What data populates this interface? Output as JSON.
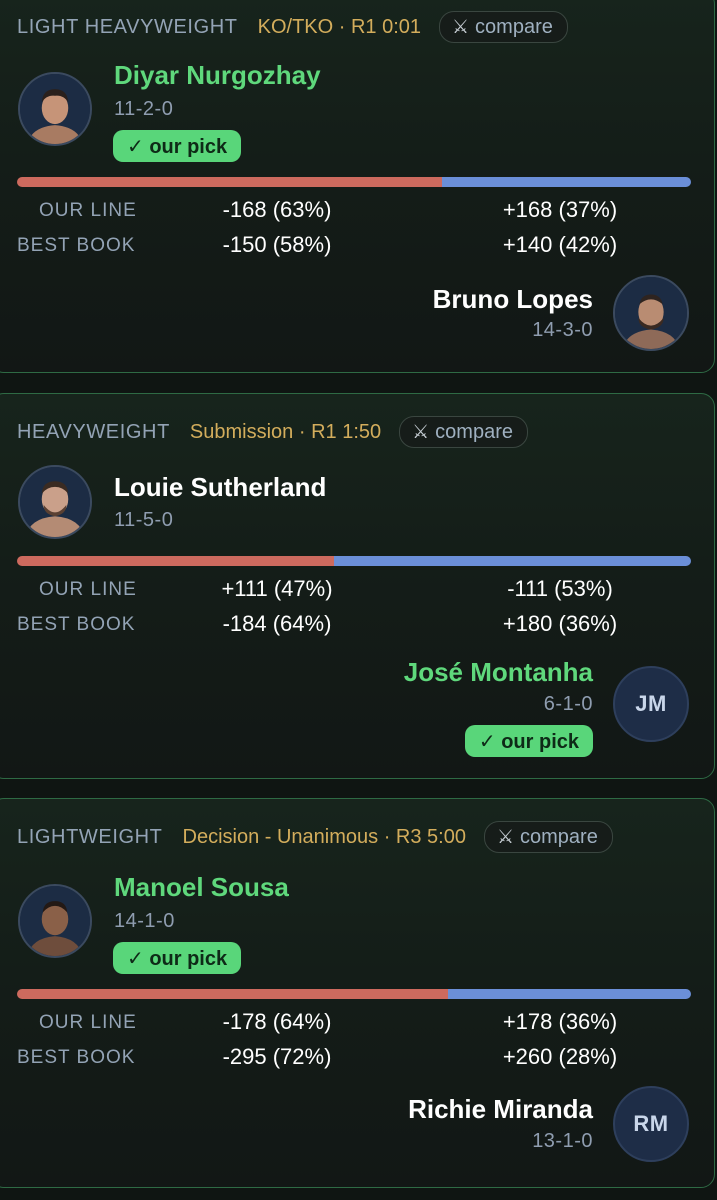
{
  "fights": [
    {
      "weight_class": "LIGHT HEAVYWEIGHT",
      "method": "KO/TKO · R1 0:01",
      "compare_label": "compare",
      "red": {
        "name": "Diyar Nurgozhay",
        "record": "11-2-0",
        "pick": true
      },
      "blue": {
        "name": "Bruno Lopes",
        "record": "14-3-0",
        "pick": false
      },
      "red_pct": 63,
      "our_line": {
        "label": "OUR LINE",
        "red": "-168 (63%)",
        "blue": "+168 (37%)"
      },
      "best_book": {
        "label": "BEST BOOK",
        "red": "-150 (58%)",
        "blue": "+140 (42%)"
      }
    },
    {
      "weight_class": "HEAVYWEIGHT",
      "method": "Submission · R1 1:50",
      "compare_label": "compare",
      "red": {
        "name": "Louie Sutherland",
        "record": "11-5-0",
        "pick": false
      },
      "blue": {
        "name": "José Montanha",
        "record": "6-1-0",
        "pick": true,
        "initials": "JM"
      },
      "red_pct": 47,
      "our_line": {
        "label": "OUR LINE",
        "red": "+111 (47%)",
        "blue": "-111 (53%)"
      },
      "best_book": {
        "label": "BEST BOOK",
        "red": "-184 (64%)",
        "blue": "+180 (36%)"
      }
    },
    {
      "weight_class": "LIGHTWEIGHT",
      "method": "Decision - Unanimous · R3 5:00",
      "compare_label": "compare",
      "red": {
        "name": "Manoel Sousa",
        "record": "14-1-0",
        "pick": true
      },
      "blue": {
        "name": "Richie Miranda",
        "record": "13-1-0",
        "pick": false,
        "initials": "RM"
      },
      "red_pct": 64,
      "our_line": {
        "label": "OUR LINE",
        "red": "-178 (64%)",
        "blue": "+178 (36%)"
      },
      "best_book": {
        "label": "BEST BOOK",
        "red": "-295 (72%)",
        "blue": "+260 (28%)"
      }
    }
  ],
  "pick_badge": "✓ our pick",
  "icons": {
    "compare": "crossed-swords-icon",
    "photo": "fighter-photo"
  },
  "colors": {
    "pick_green": "#5fd87c",
    "red_bar": "#cd6a5e",
    "blue_bar": "#6b8fd8",
    "method_gold": "#d3ad5c"
  }
}
